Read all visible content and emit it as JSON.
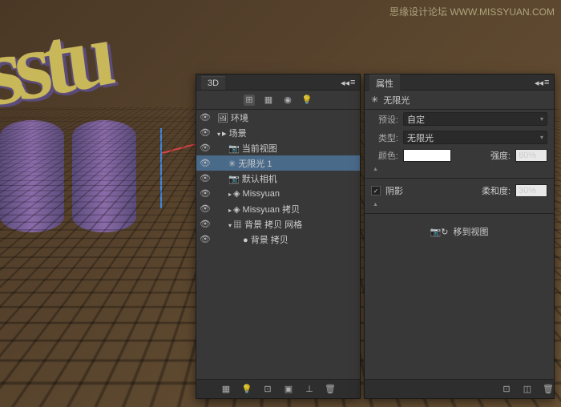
{
  "watermark": "思缘设计论坛 WWW.MISSYUAN.COM",
  "panel3d": {
    "title": "3D",
    "items": [
      {
        "eye": true,
        "depth": 0,
        "icon": "🖼",
        "label": "环境",
        "sel": false
      },
      {
        "eye": true,
        "depth": 0,
        "icon": "▸",
        "label": "场景",
        "sel": false,
        "pre": "▾"
      },
      {
        "eye": true,
        "depth": 1,
        "icon": "📷",
        "label": "当前视图",
        "sel": false
      },
      {
        "eye": true,
        "depth": 1,
        "icon": "✳",
        "label": "无限光 1",
        "sel": true
      },
      {
        "eye": true,
        "depth": 1,
        "icon": "📷",
        "label": "默认相机",
        "sel": false
      },
      {
        "eye": true,
        "depth": 1,
        "icon": "◈",
        "label": "Missyuan",
        "sel": false,
        "pre": "▸"
      },
      {
        "eye": true,
        "depth": 1,
        "icon": "◈",
        "label": "Missyuan 拷贝",
        "sel": false,
        "pre": "▸"
      },
      {
        "eye": true,
        "depth": 1,
        "icon": "▦",
        "label": "背景 拷贝 网格",
        "sel": false,
        "pre": "▾"
      },
      {
        "eye": true,
        "depth": 2,
        "icon": "●",
        "label": "背景 拷贝",
        "sel": false
      }
    ]
  },
  "props": {
    "title": "属性",
    "subtitle": "无限光",
    "preset_label": "预设:",
    "preset_value": "自定",
    "type_label": "类型:",
    "type_value": "无限光",
    "color_label": "颜色:",
    "intensity_label": "强度:",
    "intensity_value": "80%",
    "shadow_label": "阴影",
    "shadow_checked": true,
    "softness_label": "柔和度:",
    "softness_value": "30%",
    "move_label": "移到视图"
  }
}
